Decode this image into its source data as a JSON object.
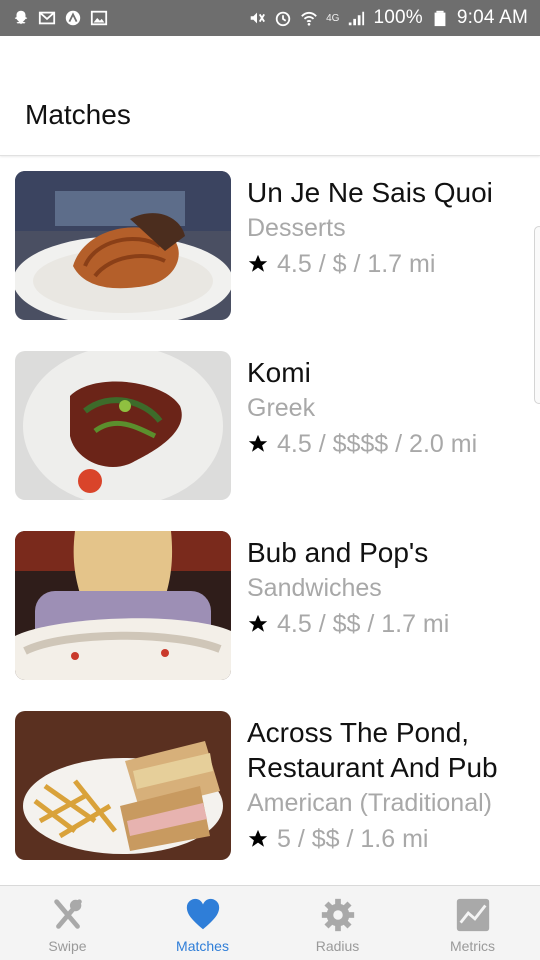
{
  "status_bar": {
    "battery": "100%",
    "time": "9:04 AM",
    "network": "4G",
    "icons_left": [
      "snapchat-icon",
      "gmail-icon",
      "app-icon",
      "gallery-icon"
    ],
    "icons_right": [
      "mute-icon",
      "alarm-icon",
      "wifi-icon",
      "signal-icon",
      "battery-icon"
    ]
  },
  "header": {
    "title": "Matches"
  },
  "matches": [
    {
      "name": "Un Je Ne Sais Quoi",
      "category": "Desserts",
      "rating": "4.5",
      "price": "$",
      "distance": "1.7 mi",
      "meta": "4.5 / $ / 1.7 mi"
    },
    {
      "name": "Komi",
      "category": "Greek",
      "rating": "4.5",
      "price": "$$$$",
      "distance": "2.0 mi",
      "meta": "4.5 / $$$$ / 2.0 mi"
    },
    {
      "name": "Bub and Pop's",
      "category": "Sandwiches",
      "rating": "4.5",
      "price": "$$",
      "distance": "1.7 mi",
      "meta": "4.5 / $$ / 1.7 mi"
    },
    {
      "name_line1": "Across The Pond,",
      "name_line2": "Restaurant And Pub",
      "category": "American (Traditional)",
      "rating": "5",
      "price": "$$",
      "distance": "1.6 mi",
      "meta": "5 / $$ / 1.6 mi"
    }
  ],
  "bottom_nav": {
    "items": [
      {
        "label": "Swipe",
        "icon": "fork-knife-icon"
      },
      {
        "label": "Matches",
        "icon": "heart-icon",
        "active": true
      },
      {
        "label": "Radius",
        "icon": "gear-icon"
      },
      {
        "label": "Metrics",
        "icon": "chart-icon"
      }
    ]
  },
  "colors": {
    "status_bar": "#6e6e6e",
    "accent": "#2f7ed8",
    "muted_text": "#a8a8a8",
    "nav_bg": "#f4f4f4"
  }
}
